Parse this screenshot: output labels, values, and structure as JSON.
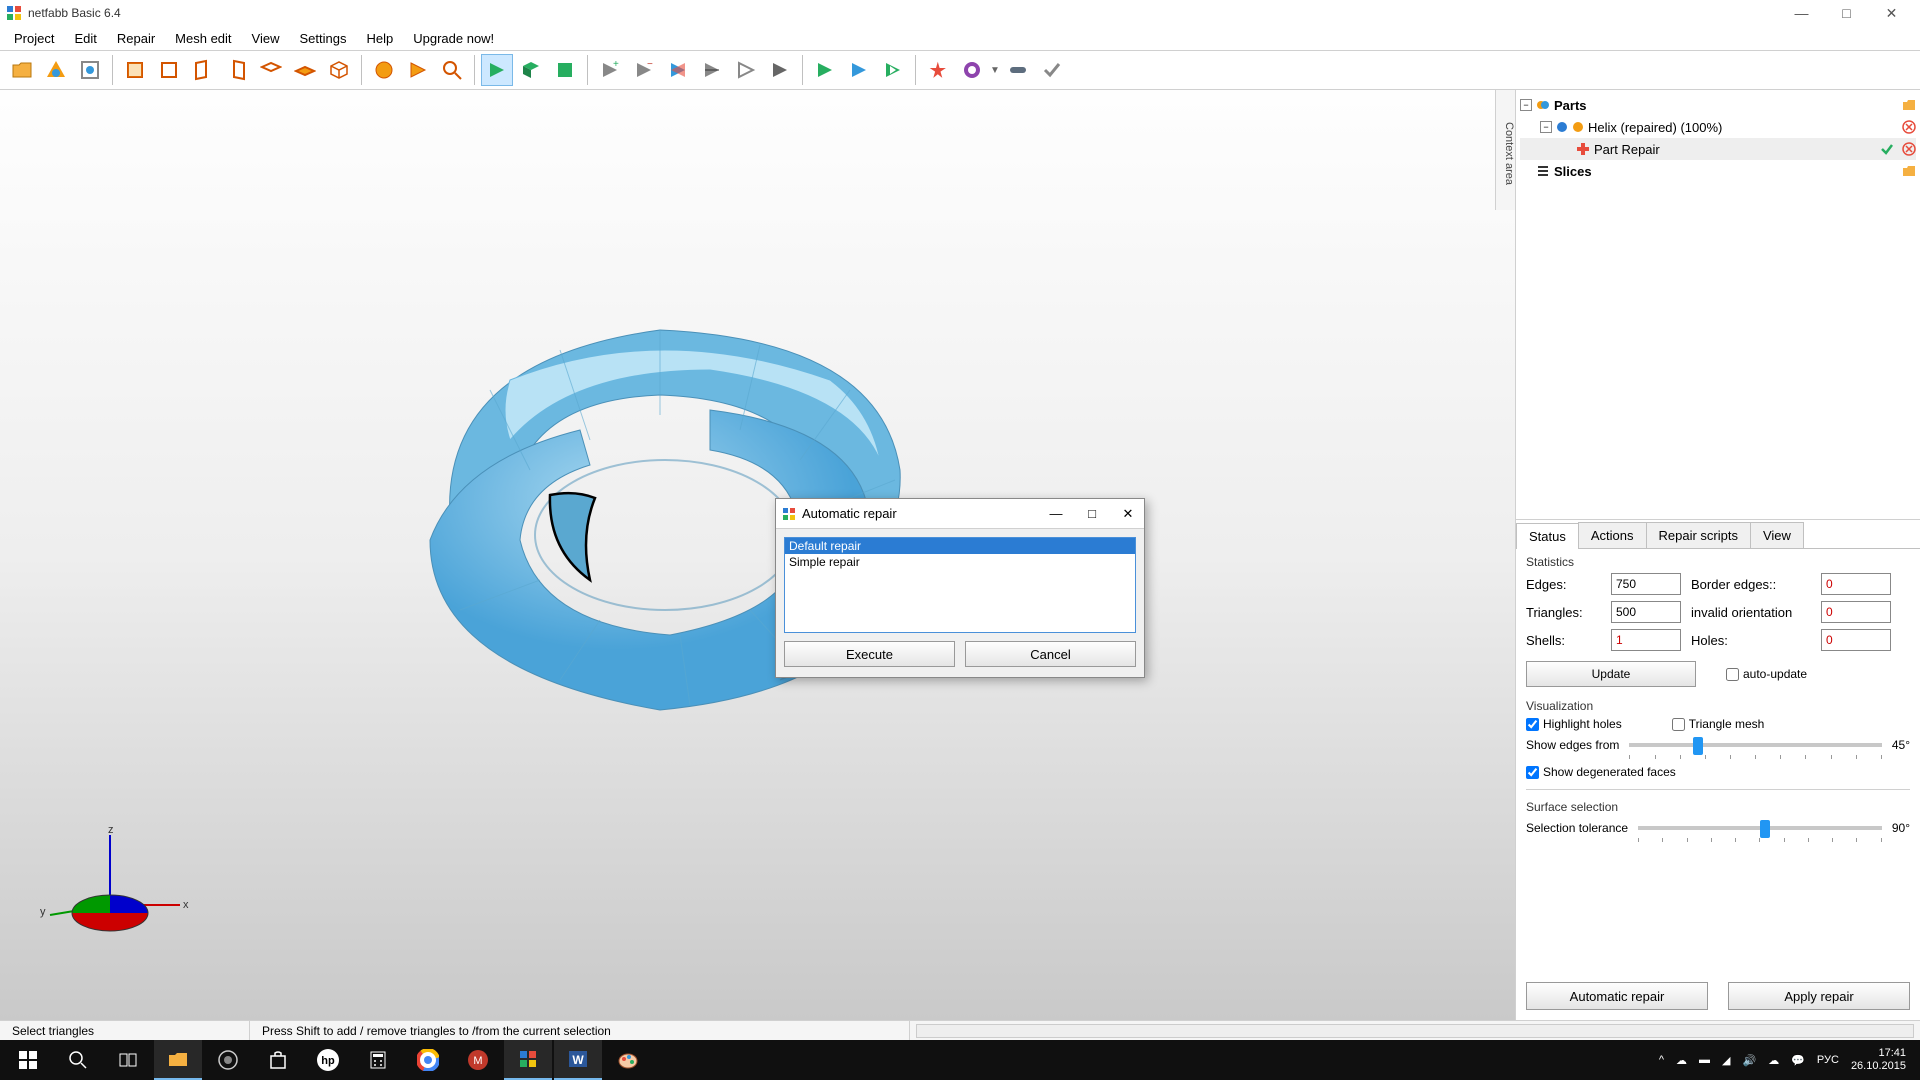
{
  "window": {
    "title": "netfabb Basic 6.4"
  },
  "menu": [
    "Project",
    "Edit",
    "Repair",
    "Mesh edit",
    "View",
    "Settings",
    "Help",
    "Upgrade now!"
  ],
  "tree": {
    "parts_label": "Parts",
    "helix_label": "Helix (repaired) (100%)",
    "part_repair_label": "Part Repair",
    "slices_label": "Slices"
  },
  "tabs": [
    "Status",
    "Actions",
    "Repair scripts",
    "View"
  ],
  "panel": {
    "statistics_title": "Statistics",
    "edges_label": "Edges:",
    "edges_value": "750",
    "border_edges_label": "Border edges::",
    "border_edges_value": "0",
    "triangles_label": "Triangles:",
    "triangles_value": "500",
    "invalid_label": "invalid orientation",
    "invalid_value": "0",
    "shells_label": "Shells:",
    "shells_value": "1",
    "holes_label": "Holes:",
    "holes_value": "0",
    "update_btn": "Update",
    "auto_update_label": "auto-update",
    "visualization_title": "Visualization",
    "highlight_holes": "Highlight holes",
    "triangle_mesh": "Triangle mesh",
    "show_edges_from": "Show edges from",
    "edges_angle": "45°",
    "show_degenerated": "Show degenerated faces",
    "surface_selection_title": "Surface selection",
    "selection_tolerance": "Selection tolerance",
    "tolerance_angle": "90°",
    "auto_repair_btn": "Automatic repair",
    "apply_repair_btn": "Apply repair"
  },
  "statusbar": {
    "left": "Select triangles",
    "mid": "Press Shift to add / remove triangles to /from the current selection"
  },
  "dialog": {
    "title": "Automatic repair",
    "options": [
      "Default repair",
      "Simple repair"
    ],
    "execute": "Execute",
    "cancel": "Cancel"
  },
  "context_label": "Context area",
  "taskbar": {
    "lang": "РУС",
    "time": "17:41",
    "date": "26.10.2015"
  }
}
